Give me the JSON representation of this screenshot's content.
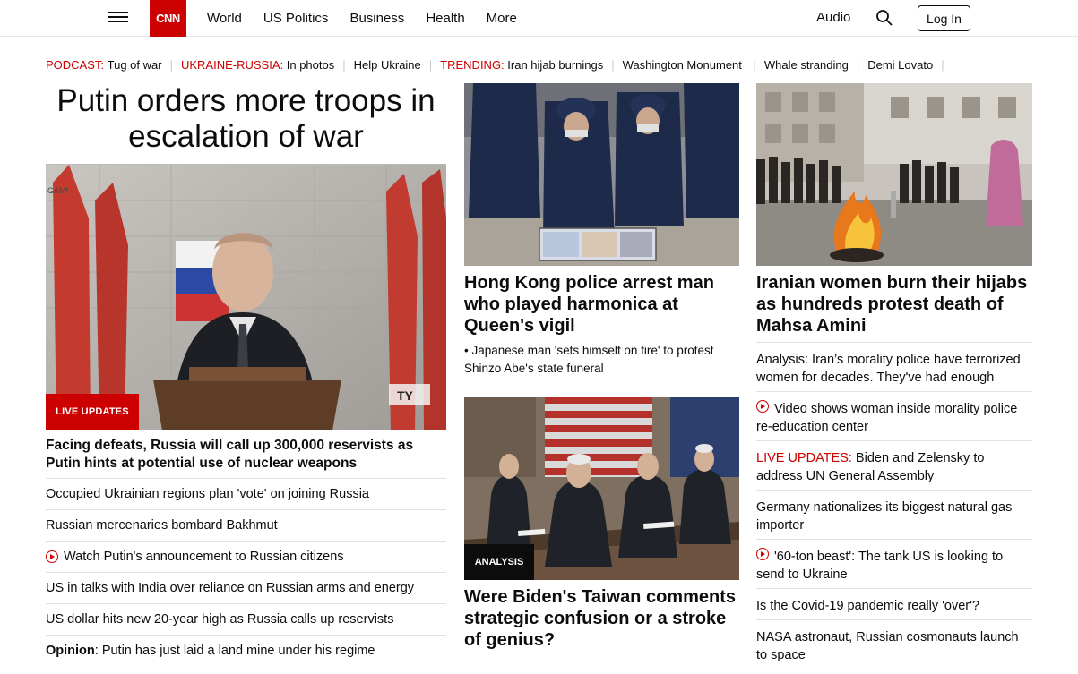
{
  "header": {
    "nav": [
      "World",
      "US Politics",
      "Business",
      "Health",
      "More"
    ],
    "audio": "Audio",
    "login": "Log In",
    "logo": "CNN"
  },
  "trending": [
    {
      "label": "PODCAST:",
      "text": "Tug of war"
    },
    {
      "label": "UKRAINE-RUSSIA:",
      "text": "In photos"
    },
    {
      "label": "",
      "text": "Help Ukraine"
    },
    {
      "label": "TRENDING:",
      "text": "Iran hijab burnings"
    },
    {
      "label": "",
      "text": "Washington Monument"
    },
    {
      "label": "",
      "text": "Whale stranding"
    },
    {
      "label": "",
      "text": "Demi Lovato"
    }
  ],
  "left": {
    "headline": "Putin orders more troops in escalation of war",
    "badge": "LIVE UPDATES",
    "subhead": "Facing defeats, Russia will call up 300,000 reservists as Putin hints at potential use of nuclear weapons",
    "links": [
      {
        "text": "Occupied Ukrainian regions plan 'vote' on joining Russia",
        "video": false
      },
      {
        "text": "Russian mercenaries bombard Bakhmut",
        "video": false
      },
      {
        "text": "Watch Putin's announcement to Russian citizens",
        "video": true
      },
      {
        "text": "US in talks with India over reliance on Russian arms and energy",
        "video": false
      },
      {
        "text": "US dollar hits new 20-year high as Russia calls up reservists",
        "video": false
      }
    ],
    "opinion_label": "Opinion",
    "opinion_text": ": Putin has just laid a land mine under his regime"
  },
  "middle": {
    "hk_headline": "Hong Kong police arrest man who played harmonica at Queen's vigil",
    "hk_sub": "• Japanese man 'sets himself on fire' to protest Shinzo Abe's state funeral",
    "analysis_badge": "ANALYSIS",
    "biden_headline": "Were Biden's Taiwan comments strategic confusion or a stroke of genius?"
  },
  "right": {
    "iran_headline": "Iranian women burn their hijabs as hundreds protest death of Mahsa Amini",
    "links": [
      {
        "prefix": "",
        "text": "Analysis: Iran’s morality police have terrorized women for decades. They've had enough",
        "video": false
      },
      {
        "prefix": "",
        "text": "Video shows woman inside morality police re-education center",
        "video": true
      },
      {
        "prefix": "LIVE UPDATES:",
        "text": " Biden and Zelensky to address UN General Assembly",
        "video": false
      },
      {
        "prefix": "",
        "text": "Germany nationalizes its biggest natural gas importer",
        "video": false
      },
      {
        "prefix": "",
        "text": "'60-ton beast': The tank US is looking to send to Ukraine",
        "video": true
      },
      {
        "prefix": "",
        "text": "Is the Covid-19 pandemic really 'over'?",
        "video": false
      },
      {
        "prefix": "",
        "text": "NASA astronaut, Russian cosmonauts launch to space",
        "video": false
      }
    ]
  },
  "colors": {
    "brand": "#cc0000",
    "text": "#0c0c0c"
  }
}
